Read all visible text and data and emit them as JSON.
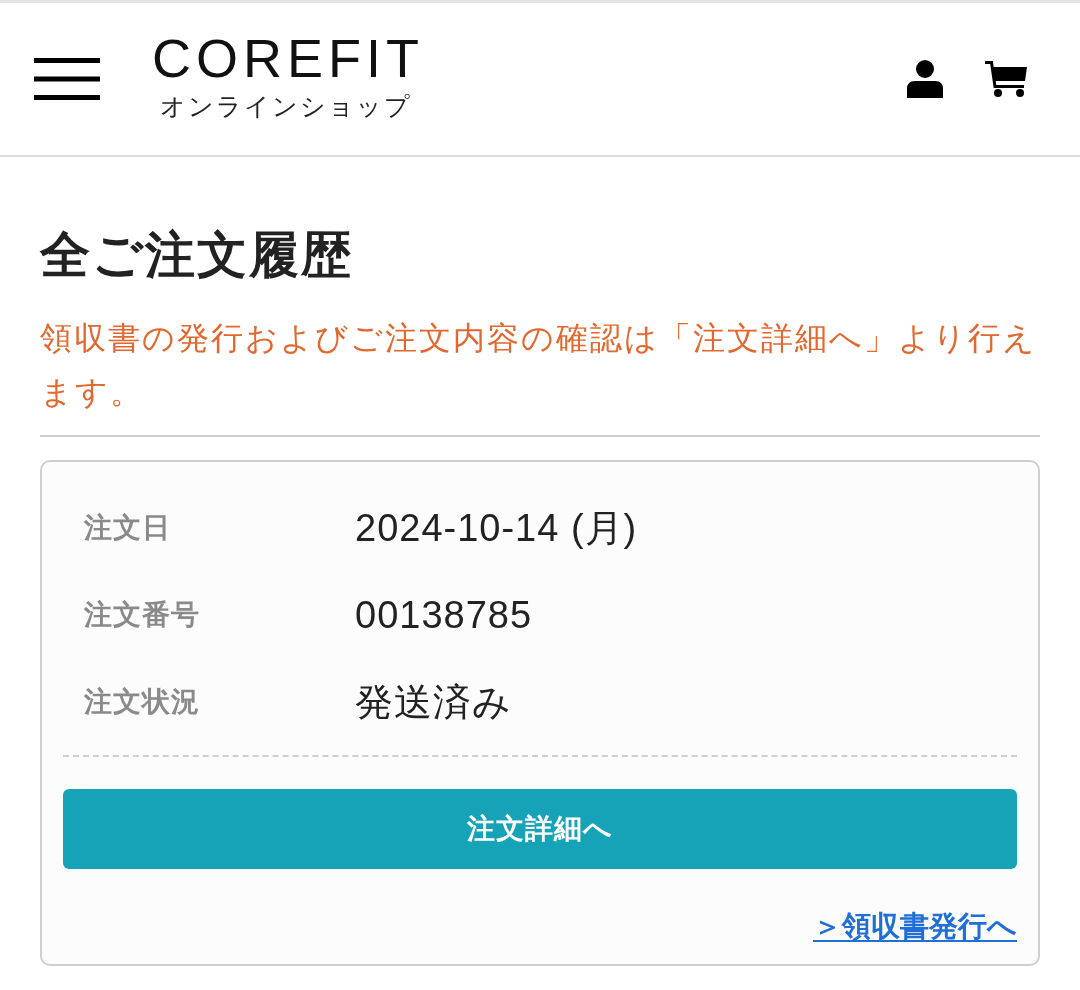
{
  "header": {
    "logo": "COREFIT",
    "logo_subtitle": "オンラインショップ"
  },
  "page": {
    "title": "全ご注文履歴",
    "notice": "領収書の発行およびご注文内容の確認は「注文詳細へ」より行えます。"
  },
  "orders": [
    {
      "fields": [
        {
          "label": "注文日",
          "value": "2024-10-14 (月)"
        },
        {
          "label": "注文番号",
          "value": "00138785"
        },
        {
          "label": "注文状況",
          "value": "発送済み"
        }
      ],
      "detail_button": "注文詳細へ",
      "receipt_link": "＞領収書発行へ"
    }
  ]
}
